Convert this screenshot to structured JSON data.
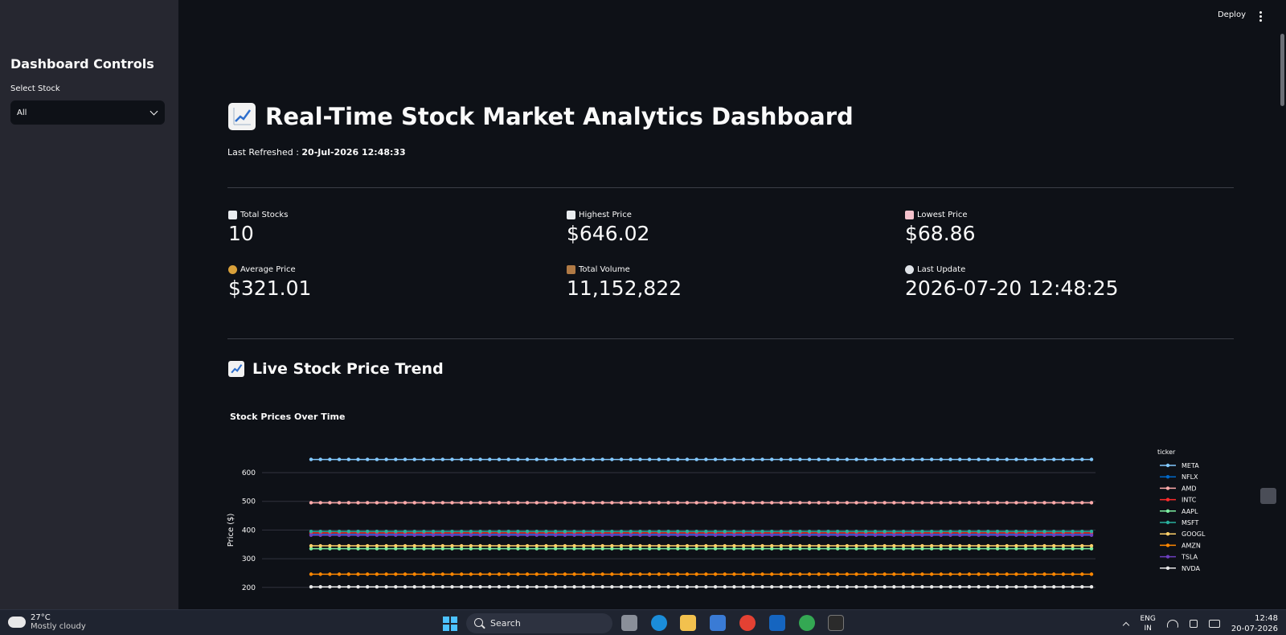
{
  "sidebar": {
    "title": "Dashboard Controls",
    "select_label": "Select Stock",
    "select_value": "All"
  },
  "header": {
    "deploy_label": "Deploy"
  },
  "main": {
    "title": "Real-Time Stock Market Analytics Dashboard",
    "refreshed_prefix": "Last Refreshed : ",
    "refreshed_value": "20-Jul-2026 12:48:33",
    "metrics": [
      {
        "label": "Total Stocks",
        "value": "10",
        "icon": "bar-chart-icon"
      },
      {
        "label": "Highest Price",
        "value": "$646.02",
        "icon": "chart-up-icon"
      },
      {
        "label": "Lowest Price",
        "value": "$68.86",
        "icon": "chart-down-icon"
      },
      {
        "label": "Average Price",
        "value": "$321.01",
        "icon": "money-bag-icon"
      },
      {
        "label": "Total Volume",
        "value": "11,152,822",
        "icon": "package-icon"
      },
      {
        "label": "Last Update",
        "value": "2026-07-20 12:48:25",
        "icon": "clock-icon"
      }
    ],
    "section_title": "Live Stock Price Trend",
    "chart_title": "Stock Prices Over Time"
  },
  "chart_data": {
    "type": "line",
    "title": "Stock Prices Over Time",
    "ylabel": "Price ($)",
    "y_ticks": [
      200,
      300,
      400,
      500,
      600
    ],
    "legend_title": "ticker",
    "legend_position": "right",
    "points_per_series": 84,
    "series": [
      {
        "name": "META",
        "value": 646,
        "color": "#83c9ff"
      },
      {
        "name": "NFLX",
        "value": 385,
        "color": "#0068c9"
      },
      {
        "name": "AMD",
        "value": 495,
        "color": "#ffabab"
      },
      {
        "name": "INTC",
        "value": 390,
        "color": "#ff2b2b"
      },
      {
        "name": "AAPL",
        "value": 335,
        "color": "#7defa1"
      },
      {
        "name": "MSFT",
        "value": 395,
        "color": "#29b09d"
      },
      {
        "name": "GOOGL",
        "value": 345,
        "color": "#ffd16a"
      },
      {
        "name": "AMZN",
        "value": 246,
        "color": "#ff8700"
      },
      {
        "name": "TSLA",
        "value": 382,
        "color": "#6d3fc0"
      },
      {
        "name": "NVDA",
        "value": 202,
        "color": "#e8e8e8"
      }
    ]
  },
  "taskbar": {
    "weather_temp": "27°C",
    "weather_desc": "Mostly cloudy",
    "search_placeholder": "Search",
    "lang_1": "ENG",
    "lang_2": "IN",
    "time": "12:48",
    "date": "20-07-2026"
  }
}
